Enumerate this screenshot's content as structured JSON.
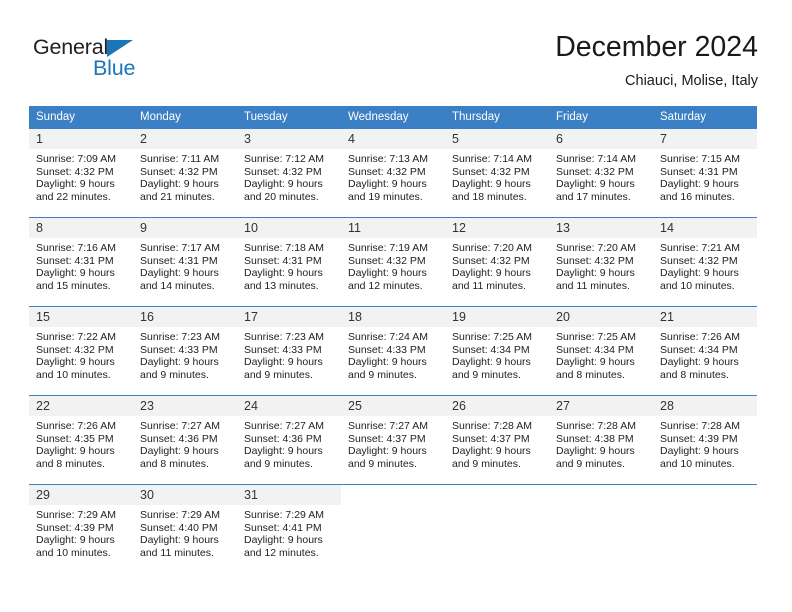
{
  "brand": {
    "name_part1": "General",
    "name_part2": "Blue",
    "accent_color": "#1b75bb"
  },
  "header": {
    "title": "December 2024",
    "subtitle": "Chiauci, Molise, Italy"
  },
  "theme": {
    "header_row_bg": "#3b7fc4",
    "daynum_bg": "#f2f2f2",
    "cell_border": "#3b7fc4"
  },
  "weekdays": [
    "Sunday",
    "Monday",
    "Tuesday",
    "Wednesday",
    "Thursday",
    "Friday",
    "Saturday"
  ],
  "weeks": [
    [
      {
        "day": "1",
        "sunrise": "Sunrise: 7:09 AM",
        "sunset": "Sunset: 4:32 PM",
        "daylight1": "Daylight: 9 hours",
        "daylight2": "and 22 minutes."
      },
      {
        "day": "2",
        "sunrise": "Sunrise: 7:11 AM",
        "sunset": "Sunset: 4:32 PM",
        "daylight1": "Daylight: 9 hours",
        "daylight2": "and 21 minutes."
      },
      {
        "day": "3",
        "sunrise": "Sunrise: 7:12 AM",
        "sunset": "Sunset: 4:32 PM",
        "daylight1": "Daylight: 9 hours",
        "daylight2": "and 20 minutes."
      },
      {
        "day": "4",
        "sunrise": "Sunrise: 7:13 AM",
        "sunset": "Sunset: 4:32 PM",
        "daylight1": "Daylight: 9 hours",
        "daylight2": "and 19 minutes."
      },
      {
        "day": "5",
        "sunrise": "Sunrise: 7:14 AM",
        "sunset": "Sunset: 4:32 PM",
        "daylight1": "Daylight: 9 hours",
        "daylight2": "and 18 minutes."
      },
      {
        "day": "6",
        "sunrise": "Sunrise: 7:14 AM",
        "sunset": "Sunset: 4:32 PM",
        "daylight1": "Daylight: 9 hours",
        "daylight2": "and 17 minutes."
      },
      {
        "day": "7",
        "sunrise": "Sunrise: 7:15 AM",
        "sunset": "Sunset: 4:31 PM",
        "daylight1": "Daylight: 9 hours",
        "daylight2": "and 16 minutes."
      }
    ],
    [
      {
        "day": "8",
        "sunrise": "Sunrise: 7:16 AM",
        "sunset": "Sunset: 4:31 PM",
        "daylight1": "Daylight: 9 hours",
        "daylight2": "and 15 minutes."
      },
      {
        "day": "9",
        "sunrise": "Sunrise: 7:17 AM",
        "sunset": "Sunset: 4:31 PM",
        "daylight1": "Daylight: 9 hours",
        "daylight2": "and 14 minutes."
      },
      {
        "day": "10",
        "sunrise": "Sunrise: 7:18 AM",
        "sunset": "Sunset: 4:31 PM",
        "daylight1": "Daylight: 9 hours",
        "daylight2": "and 13 minutes."
      },
      {
        "day": "11",
        "sunrise": "Sunrise: 7:19 AM",
        "sunset": "Sunset: 4:32 PM",
        "daylight1": "Daylight: 9 hours",
        "daylight2": "and 12 minutes."
      },
      {
        "day": "12",
        "sunrise": "Sunrise: 7:20 AM",
        "sunset": "Sunset: 4:32 PM",
        "daylight1": "Daylight: 9 hours",
        "daylight2": "and 11 minutes."
      },
      {
        "day": "13",
        "sunrise": "Sunrise: 7:20 AM",
        "sunset": "Sunset: 4:32 PM",
        "daylight1": "Daylight: 9 hours",
        "daylight2": "and 11 minutes."
      },
      {
        "day": "14",
        "sunrise": "Sunrise: 7:21 AM",
        "sunset": "Sunset: 4:32 PM",
        "daylight1": "Daylight: 9 hours",
        "daylight2": "and 10 minutes."
      }
    ],
    [
      {
        "day": "15",
        "sunrise": "Sunrise: 7:22 AM",
        "sunset": "Sunset: 4:32 PM",
        "daylight1": "Daylight: 9 hours",
        "daylight2": "and 10 minutes."
      },
      {
        "day": "16",
        "sunrise": "Sunrise: 7:23 AM",
        "sunset": "Sunset: 4:33 PM",
        "daylight1": "Daylight: 9 hours",
        "daylight2": "and 9 minutes."
      },
      {
        "day": "17",
        "sunrise": "Sunrise: 7:23 AM",
        "sunset": "Sunset: 4:33 PM",
        "daylight1": "Daylight: 9 hours",
        "daylight2": "and 9 minutes."
      },
      {
        "day": "18",
        "sunrise": "Sunrise: 7:24 AM",
        "sunset": "Sunset: 4:33 PM",
        "daylight1": "Daylight: 9 hours",
        "daylight2": "and 9 minutes."
      },
      {
        "day": "19",
        "sunrise": "Sunrise: 7:25 AM",
        "sunset": "Sunset: 4:34 PM",
        "daylight1": "Daylight: 9 hours",
        "daylight2": "and 9 minutes."
      },
      {
        "day": "20",
        "sunrise": "Sunrise: 7:25 AM",
        "sunset": "Sunset: 4:34 PM",
        "daylight1": "Daylight: 9 hours",
        "daylight2": "and 8 minutes."
      },
      {
        "day": "21",
        "sunrise": "Sunrise: 7:26 AM",
        "sunset": "Sunset: 4:34 PM",
        "daylight1": "Daylight: 9 hours",
        "daylight2": "and 8 minutes."
      }
    ],
    [
      {
        "day": "22",
        "sunrise": "Sunrise: 7:26 AM",
        "sunset": "Sunset: 4:35 PM",
        "daylight1": "Daylight: 9 hours",
        "daylight2": "and 8 minutes."
      },
      {
        "day": "23",
        "sunrise": "Sunrise: 7:27 AM",
        "sunset": "Sunset: 4:36 PM",
        "daylight1": "Daylight: 9 hours",
        "daylight2": "and 8 minutes."
      },
      {
        "day": "24",
        "sunrise": "Sunrise: 7:27 AM",
        "sunset": "Sunset: 4:36 PM",
        "daylight1": "Daylight: 9 hours",
        "daylight2": "and 9 minutes."
      },
      {
        "day": "25",
        "sunrise": "Sunrise: 7:27 AM",
        "sunset": "Sunset: 4:37 PM",
        "daylight1": "Daylight: 9 hours",
        "daylight2": "and 9 minutes."
      },
      {
        "day": "26",
        "sunrise": "Sunrise: 7:28 AM",
        "sunset": "Sunset: 4:37 PM",
        "daylight1": "Daylight: 9 hours",
        "daylight2": "and 9 minutes."
      },
      {
        "day": "27",
        "sunrise": "Sunrise: 7:28 AM",
        "sunset": "Sunset: 4:38 PM",
        "daylight1": "Daylight: 9 hours",
        "daylight2": "and 9 minutes."
      },
      {
        "day": "28",
        "sunrise": "Sunrise: 7:28 AM",
        "sunset": "Sunset: 4:39 PM",
        "daylight1": "Daylight: 9 hours",
        "daylight2": "and 10 minutes."
      }
    ],
    [
      {
        "day": "29",
        "sunrise": "Sunrise: 7:29 AM",
        "sunset": "Sunset: 4:39 PM",
        "daylight1": "Daylight: 9 hours",
        "daylight2": "and 10 minutes."
      },
      {
        "day": "30",
        "sunrise": "Sunrise: 7:29 AM",
        "sunset": "Sunset: 4:40 PM",
        "daylight1": "Daylight: 9 hours",
        "daylight2": "and 11 minutes."
      },
      {
        "day": "31",
        "sunrise": "Sunrise: 7:29 AM",
        "sunset": "Sunset: 4:41 PM",
        "daylight1": "Daylight: 9 hours",
        "daylight2": "and 12 minutes."
      },
      {
        "day": "",
        "sunrise": "",
        "sunset": "",
        "daylight1": "",
        "daylight2": ""
      },
      {
        "day": "",
        "sunrise": "",
        "sunset": "",
        "daylight1": "",
        "daylight2": ""
      },
      {
        "day": "",
        "sunrise": "",
        "sunset": "",
        "daylight1": "",
        "daylight2": ""
      },
      {
        "day": "",
        "sunrise": "",
        "sunset": "",
        "daylight1": "",
        "daylight2": ""
      }
    ]
  ]
}
